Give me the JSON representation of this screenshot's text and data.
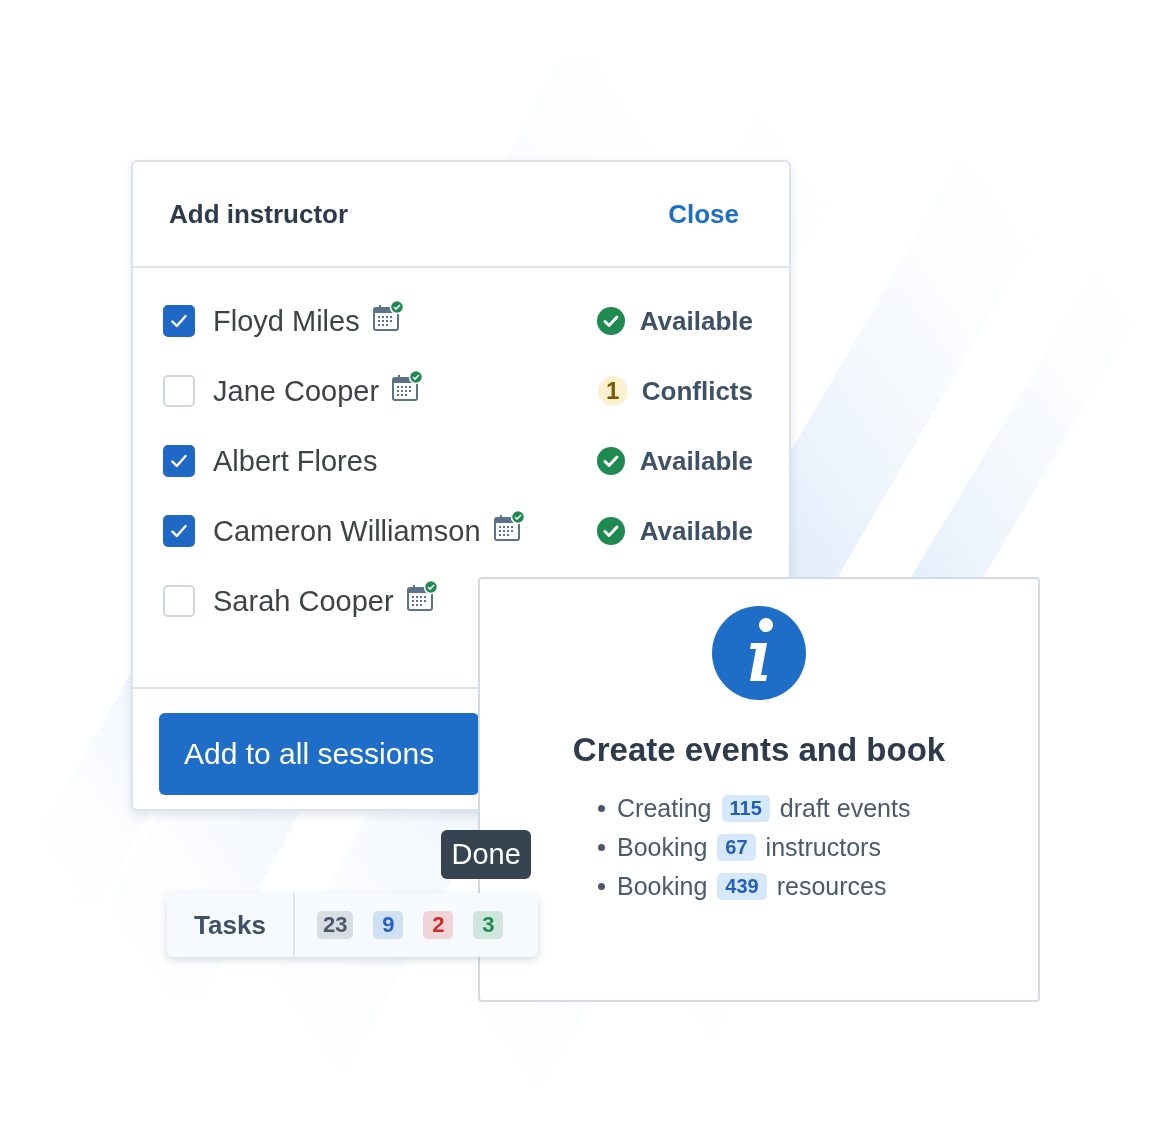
{
  "dialog": {
    "title": "Add instructor",
    "close": "Close",
    "instructors": [
      {
        "name": "Floyd Miles",
        "checked": true,
        "calendar": true,
        "status": {
          "kind": "available",
          "label": "Available"
        }
      },
      {
        "name": "Jane Cooper",
        "checked": false,
        "calendar": true,
        "status": {
          "kind": "conflicts",
          "count": "1",
          "label": "Conflicts"
        }
      },
      {
        "name": "Albert Flores",
        "checked": true,
        "calendar": false,
        "status": {
          "kind": "available",
          "label": "Available"
        }
      },
      {
        "name": "Cameron Williamson",
        "checked": true,
        "calendar": true,
        "status": {
          "kind": "available",
          "label": "Available"
        }
      },
      {
        "name": "Sarah Cooper",
        "checked": false,
        "calendar": true
      }
    ],
    "button": "Add to all sessions"
  },
  "tasks": {
    "label": "Tasks",
    "counts": [
      {
        "value": "23",
        "color": "#4a5868"
      },
      {
        "value": "9",
        "color": "#1f63c4"
      },
      {
        "value": "2",
        "color": "#d12a2a"
      },
      {
        "value": "3",
        "color": "#1e8a4f",
        "tooltip": "Done"
      }
    ]
  },
  "info": {
    "title": "Create events and book",
    "items": [
      {
        "before": "Creating",
        "count": "115",
        "after": "draft events"
      },
      {
        "before": "Booking",
        "count": "67",
        "after": "instructors"
      },
      {
        "before": "Booking",
        "count": "439",
        "after": "resources"
      }
    ]
  }
}
